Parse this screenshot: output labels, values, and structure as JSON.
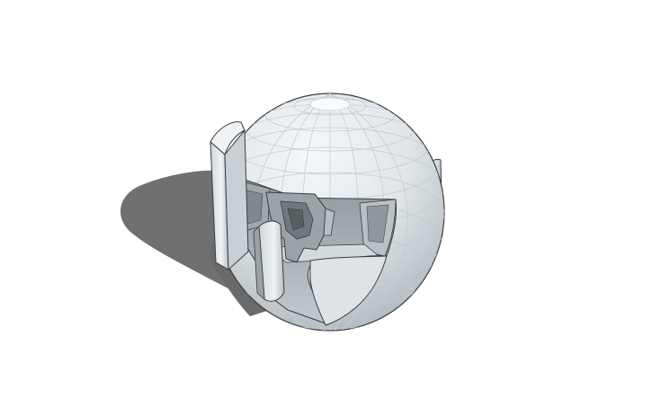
{
  "scene": {
    "background_color": "#ffffff",
    "shadow_color": "#6f6f6f",
    "model_colors": {
      "light": "#f3f6f8",
      "mid": "#d6dde2",
      "dark": "#a8b0b5",
      "edge": "#3c3c3c"
    },
    "icon": "3d-model-render"
  }
}
